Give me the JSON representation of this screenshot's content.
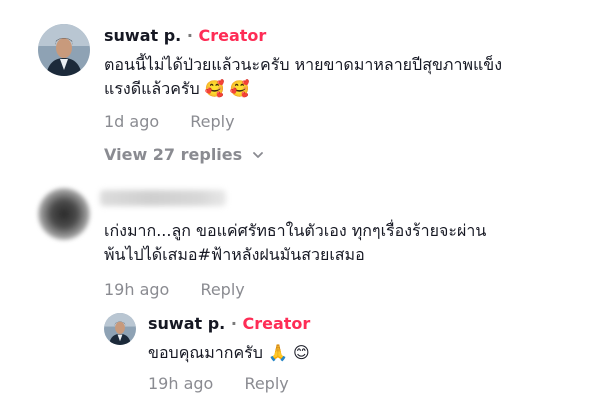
{
  "comments": [
    {
      "author": "suwat p.",
      "separator": "·",
      "badge": "Creator",
      "text_line1": "ตอนนี้ไม่ได้ป่วยแล้วนะครับ หายขาดมาหลายปีสุขภาพแข็ง",
      "text_line2": "แรงดีแล้วครับ 🥰 🥰",
      "time": "1d ago",
      "reply_label": "Reply",
      "view_replies_label": "View 27 replies"
    },
    {
      "author": "",
      "text_line1": "เก่งมาก...ลูก ขอแค่ศรัทธาในตัวเอง ทุกๆเรื่องร้ายจะผ่าน",
      "text_line2": "พ้นไปได้เสมอ#ฟ้าหลังฝนมันสวยเสมอ",
      "time": "19h ago",
      "reply_label": "Reply"
    }
  ],
  "reply": {
    "author": "suwat p.",
    "separator": "·",
    "badge": "Creator",
    "text": "ขอบคุณมากครับ 🙏 😊",
    "time": "19h ago",
    "reply_label": "Reply"
  },
  "icons": {
    "chevron": "⌄"
  },
  "colors": {
    "creator_badge": "#fe2c55",
    "meta_text": "#8a8b91",
    "primary_text": "#161823"
  }
}
